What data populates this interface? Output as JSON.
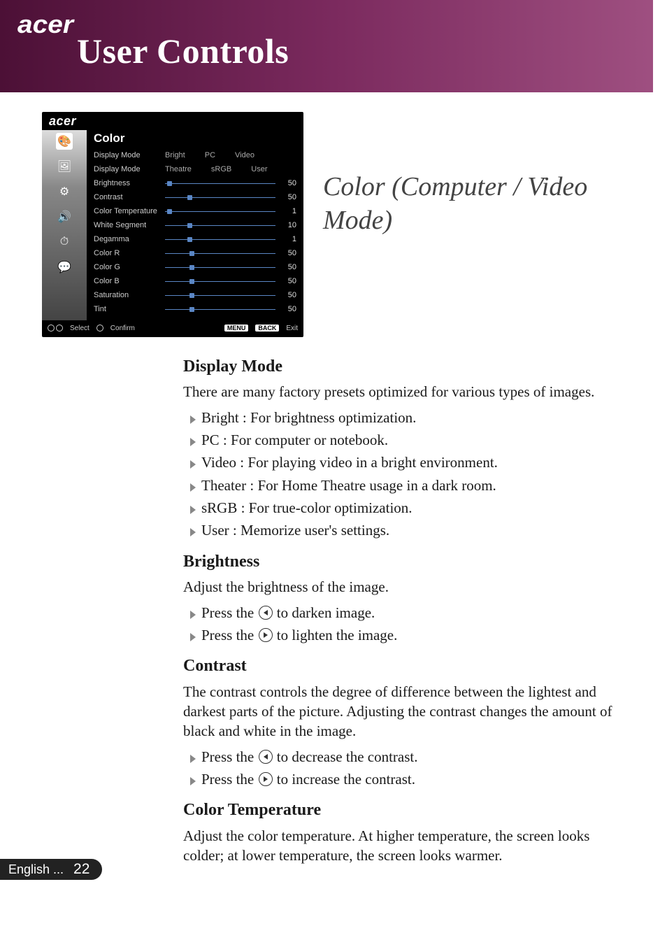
{
  "header": {
    "brand": "acer",
    "chapter": "User Controls"
  },
  "section_title": "Color (Computer / Video Mode)",
  "osd": {
    "brand": "acer",
    "heading": "Color",
    "modes_row1": {
      "label": "Display Mode",
      "opts": [
        "Bright",
        "PC",
        "Video"
      ]
    },
    "modes_row2": {
      "label": "Display Mode",
      "opts": [
        "Theatre",
        "sRGB",
        "User"
      ]
    },
    "rows": [
      {
        "label": "Brightness",
        "value": 50,
        "pos": 2
      },
      {
        "label": "Contrast",
        "value": 50,
        "pos": 20
      },
      {
        "label": "Color Temperature",
        "value": 1,
        "pos": 2
      },
      {
        "label": "White Segment",
        "value": 10,
        "pos": 20
      },
      {
        "label": "Degamma",
        "value": 1,
        "pos": 20
      },
      {
        "label": "Color R",
        "value": 50,
        "pos": 22
      },
      {
        "label": "Color G",
        "value": 50,
        "pos": 22
      },
      {
        "label": "Color B",
        "value": 50,
        "pos": 22
      },
      {
        "label": "Saturation",
        "value": 50,
        "pos": 22
      },
      {
        "label": "Tint",
        "value": 50,
        "pos": 22
      }
    ],
    "footer": {
      "select": "Select",
      "confirm": "Confirm",
      "menu": "MENU",
      "back": "BACK",
      "exit": "Exit"
    }
  },
  "body": {
    "display_mode": {
      "heading": "Display Mode",
      "intro": "There are many factory presets optimized for various types of images.",
      "items": [
        "Bright : For brightness optimization.",
        "PC : For computer or notebook.",
        "Video : For playing video in a bright environment.",
        "Theater : For Home Theatre usage in a dark room.",
        "sRGB : For true-color optimization.",
        "User : Memorize user's settings."
      ]
    },
    "brightness": {
      "heading": "Brightness",
      "intro": "Adjust the brightness of the image.",
      "left_pre": "Press the ",
      "left_post": " to darken image.",
      "right_pre": "Press the ",
      "right_post": " to lighten the image."
    },
    "contrast": {
      "heading": "Contrast",
      "intro": "The contrast controls the degree of difference between the lightest and darkest parts of the picture. Adjusting the contrast changes the amount of black and white in the image.",
      "left_pre": "Press the ",
      "left_post": " to decrease the contrast.",
      "right_pre": "Press the ",
      "right_post": " to increase the contrast."
    },
    "color_temp": {
      "heading": "Color Temperature",
      "intro": "Adjust the color temperature. At higher temperature, the screen looks colder; at lower temperature, the screen looks warmer."
    }
  },
  "footer": {
    "lang": "English ...",
    "page": "22"
  }
}
